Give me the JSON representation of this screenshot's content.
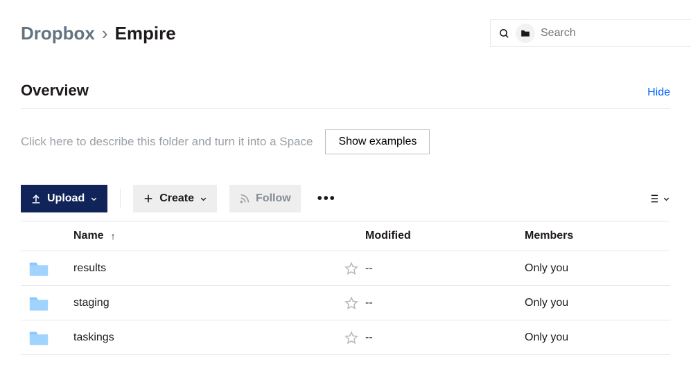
{
  "breadcrumb": {
    "parent": "Dropbox",
    "sep": "›",
    "current": "Empire"
  },
  "search": {
    "placeholder": "Search"
  },
  "overview": {
    "title": "Overview",
    "hide": "Hide",
    "prompt": "Click here to describe this folder and turn it into a Space",
    "show_examples": "Show examples"
  },
  "toolbar": {
    "upload": "Upload",
    "create": "Create",
    "follow": "Follow"
  },
  "table": {
    "headers": {
      "name": "Name",
      "modified": "Modified",
      "members": "Members"
    },
    "rows": [
      {
        "name": "results",
        "modified": "--",
        "members": "Only you"
      },
      {
        "name": "staging",
        "modified": "--",
        "members": "Only you"
      },
      {
        "name": "taskings",
        "modified": "--",
        "members": "Only you"
      }
    ]
  }
}
